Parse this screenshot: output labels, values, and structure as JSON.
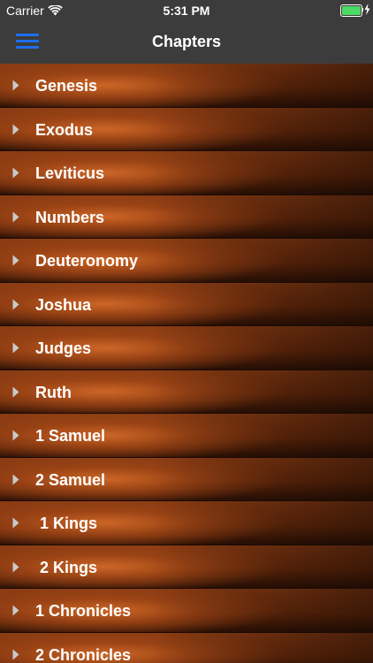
{
  "status_bar": {
    "carrier": "Carrier",
    "time": "5:31 PM",
    "battery_level": 1.0,
    "battery_color": "#4cd964",
    "icons": [
      "wifi-icon",
      "battery-icon",
      "charging-bolt-icon"
    ]
  },
  "nav": {
    "title": "Chapters",
    "menu_icon": "hamburger-menu-icon",
    "menu_color": "#1e6ff0"
  },
  "chapters": [
    {
      "label": "Genesis"
    },
    {
      "label": "Exodus"
    },
    {
      "label": "Leviticus"
    },
    {
      "label": "Numbers"
    },
    {
      "label": "Deuteronomy"
    },
    {
      "label": "Joshua"
    },
    {
      "label": "Judges"
    },
    {
      "label": "Ruth"
    },
    {
      "label": "1 Samuel"
    },
    {
      "label": "2 Samuel"
    },
    {
      "label": " 1 Kings"
    },
    {
      "label": " 2 Kings"
    },
    {
      "label": "1 Chronicles"
    },
    {
      "label": "2 Chronicles"
    }
  ],
  "row_icon": "disclosure-triangle-icon"
}
